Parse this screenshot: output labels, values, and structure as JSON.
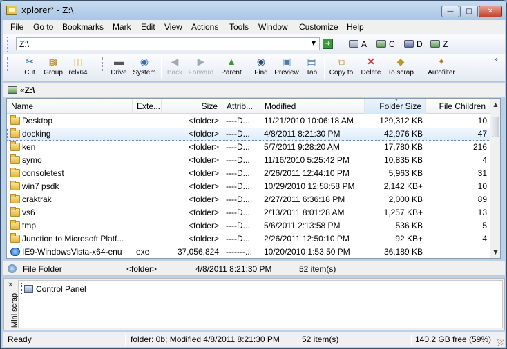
{
  "window": {
    "title": "xplorer² - Z:\\"
  },
  "menu": [
    "File",
    "Go to",
    "Bookmarks",
    "Mark",
    "Edit",
    "View",
    "Actions",
    "Tools",
    "Window",
    "Customize",
    "Help"
  ],
  "address": {
    "value": "Z:\\",
    "drives": [
      "A",
      "C",
      "D",
      "Z"
    ]
  },
  "toolbar": {
    "buttons": [
      {
        "label": "Cut",
        "icon": "scissors-icon"
      },
      {
        "label": "Group",
        "icon": "group-icon"
      },
      {
        "label": "relx64",
        "icon": "folder-icon"
      },
      {
        "label": "Drive",
        "icon": "drive-icon"
      },
      {
        "label": "System",
        "icon": "system-icon"
      },
      {
        "label": "Back",
        "icon": "back-arrow-icon"
      },
      {
        "label": "Forward",
        "icon": "forward-arrow-icon"
      },
      {
        "label": "Parent",
        "icon": "parent-folder-icon"
      },
      {
        "label": "Find",
        "icon": "binoculars-icon"
      },
      {
        "label": "Preview",
        "icon": "preview-icon"
      },
      {
        "label": "Tab",
        "icon": "tab-icon"
      },
      {
        "label": "Copy to",
        "icon": "copy-to-icon"
      },
      {
        "label": "Delete",
        "icon": "delete-x-icon"
      },
      {
        "label": "To scrap",
        "icon": "to-scrap-icon"
      },
      {
        "label": "Autofilter",
        "icon": "autofilter-icon"
      }
    ]
  },
  "path": {
    "text": "«Z:\\"
  },
  "columns": [
    "Name",
    "Exte...",
    "Size",
    "Attrib...",
    "Modified",
    "Folder Size",
    "File Children"
  ],
  "rows": [
    {
      "name": "Desktop",
      "ext": "",
      "size": "<folder>",
      "attr": "----D...",
      "modified": "11/21/2010 10:06:18 AM",
      "folder_size": "129,312 KB",
      "children": "10",
      "type": "folder"
    },
    {
      "name": "docking",
      "ext": "",
      "size": "<folder>",
      "attr": "----D...",
      "modified": "4/8/2011 8:21:30 PM",
      "folder_size": "42,976 KB",
      "children": "47",
      "type": "folder"
    },
    {
      "name": "ken",
      "ext": "",
      "size": "<folder>",
      "attr": "----D...",
      "modified": "5/7/2011 9:28:20 AM",
      "folder_size": "17,780 KB",
      "children": "216",
      "type": "folder"
    },
    {
      "name": "symo",
      "ext": "",
      "size": "<folder>",
      "attr": "----D...",
      "modified": "11/16/2010 5:25:42 PM",
      "folder_size": "10,835 KB",
      "children": "4",
      "type": "folder"
    },
    {
      "name": "consoletest",
      "ext": "",
      "size": "<folder>",
      "attr": "----D...",
      "modified": "2/26/2011 12:44:10 PM",
      "folder_size": "5,963 KB",
      "children": "31",
      "type": "folder"
    },
    {
      "name": "win7 psdk",
      "ext": "",
      "size": "<folder>",
      "attr": "----D...",
      "modified": "10/29/2010 12:58:58 PM",
      "folder_size": "2,142 KB+",
      "children": "10",
      "type": "folder"
    },
    {
      "name": "craktrak",
      "ext": "",
      "size": "<folder>",
      "attr": "----D...",
      "modified": "2/27/2011 6:36:18 PM",
      "folder_size": "2,000 KB",
      "children": "89",
      "type": "folder"
    },
    {
      "name": "vs6",
      "ext": "",
      "size": "<folder>",
      "attr": "----D...",
      "modified": "2/13/2011 8:01:28 AM",
      "folder_size": "1,257 KB+",
      "children": "13",
      "type": "folder"
    },
    {
      "name": "tmp",
      "ext": "",
      "size": "<folder>",
      "attr": "----D...",
      "modified": "5/6/2011 2:13:58 PM",
      "folder_size": "536 KB",
      "children": "5",
      "type": "folder"
    },
    {
      "name": "Junction to Microsoft Platf...",
      "ext": "",
      "size": "<folder>",
      "attr": "----D...",
      "modified": "2/26/2011 12:50:10 PM",
      "folder_size": "92 KB+",
      "children": "4",
      "type": "folder"
    },
    {
      "name": "IE9-WindowsVista-x64-enu",
      "ext": "exe",
      "size": "37,056,824",
      "attr": "-------...",
      "modified": "10/20/2010 1:53:50 PM",
      "folder_size": "36,189 KB",
      "children": "",
      "type": "exe"
    }
  ],
  "selected_row": 1,
  "info": {
    "type": "File Folder",
    "size": "<folder>",
    "modified": "4/8/2011 8:21:30 PM",
    "items": "52 item(s)"
  },
  "scrap": {
    "label": "Mini scrap",
    "item": "Control Panel"
  },
  "status": {
    "ready": "Ready",
    "detail": "folder: 0b; Modified 4/8/2011 8:21:30 PM",
    "items": "52 item(s)",
    "free": "140.2 GB free (59%)"
  },
  "colors": {
    "selection": "#dcecfc",
    "chrome": "#b9d1ea",
    "folder": "#e2b43e"
  }
}
